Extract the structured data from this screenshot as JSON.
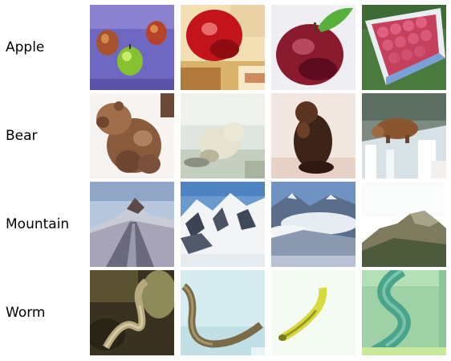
{
  "rows": [
    {
      "label": "Apple",
      "images": [
        {
          "subject": "three apples on purple cloth"
        },
        {
          "subject": "red apple close-up"
        },
        {
          "subject": "dark red apple with leaf"
        },
        {
          "subject": "basket of red apples"
        }
      ]
    },
    {
      "label": "Bear",
      "images": [
        {
          "subject": "brown bear sitting"
        },
        {
          "subject": "polar bear in snow"
        },
        {
          "subject": "dark bear sitting"
        },
        {
          "subject": "bear by waterfall"
        }
      ]
    },
    {
      "label": "Mountain",
      "images": [
        {
          "subject": "road toward mountain"
        },
        {
          "subject": "snowy mountain range"
        },
        {
          "subject": "mountains with clouds"
        },
        {
          "subject": "hazy mountain"
        }
      ]
    },
    {
      "label": "Worm",
      "images": [
        {
          "subject": "worm on dark ground"
        },
        {
          "subject": "brown worm curve"
        },
        {
          "subject": "yellow worm on white"
        },
        {
          "subject": "green worm close-up"
        }
      ]
    }
  ]
}
